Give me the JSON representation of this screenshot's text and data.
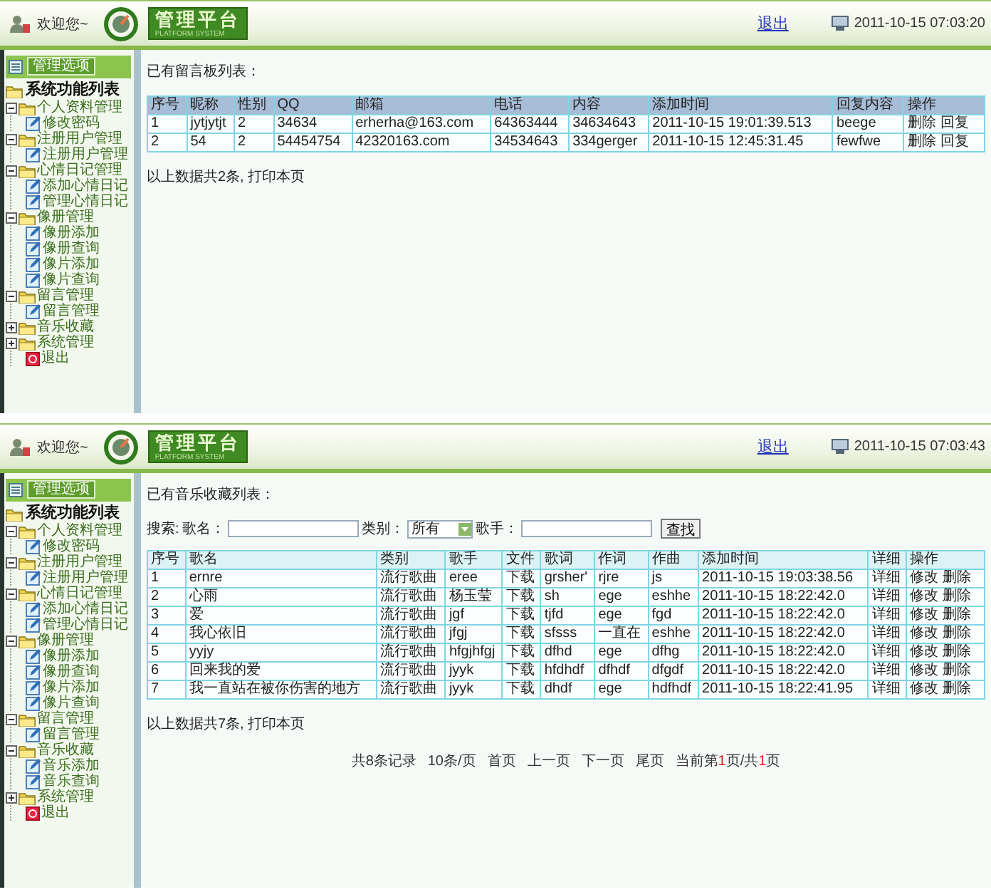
{
  "screens": [
    {
      "header": {
        "welcome": "欢迎您~",
        "brand": "管理平台",
        "brand_subtitle": "PLATFORM SYSTEM",
        "logout": "退出",
        "datetime": "2011-10-15 07:03:20"
      },
      "sidebar": {
        "tab": "管理选项",
        "title": "系统功能列表",
        "items": [
          {
            "kind": "group",
            "label": "个人资料管理",
            "expanded": true,
            "children": [
              {
                "label": "修改密码"
              }
            ]
          },
          {
            "kind": "group",
            "label": "注册用户管理",
            "expanded": true,
            "children": [
              {
                "label": "注册用户管理"
              }
            ]
          },
          {
            "kind": "group",
            "label": "心情日记管理",
            "expanded": true,
            "children": [
              {
                "label": "添加心情日记"
              },
              {
                "label": "管理心情日记"
              }
            ]
          },
          {
            "kind": "group",
            "label": "像册管理",
            "expanded": true,
            "children": [
              {
                "label": "像册添加"
              },
              {
                "label": "像册查询"
              },
              {
                "label": "像片添加"
              },
              {
                "label": "像片查询"
              }
            ]
          },
          {
            "kind": "group",
            "label": "留言管理",
            "expanded": true,
            "children": [
              {
                "label": "留言管理"
              }
            ]
          },
          {
            "kind": "group",
            "label": "音乐收藏",
            "expanded": false
          },
          {
            "kind": "group",
            "label": "系统管理",
            "expanded": false
          },
          {
            "kind": "exit",
            "label": "退出"
          }
        ]
      },
      "content": {
        "heading": "已有留言板列表：",
        "table": {
          "columns": [
            "序号",
            "昵称",
            "性别",
            "QQ",
            "邮箱",
            "电话",
            "内容",
            "添加时间",
            "回复内容",
            "操作"
          ],
          "rows": [
            {
              "cells": [
                "1",
                "jytjytjt",
                "2",
                "34634",
                "erherha@163.com",
                "64363444",
                "34634643",
                "2011-10-15 19:01:39.513",
                "beege"
              ],
              "actions": [
                "删除",
                "回复"
              ]
            },
            {
              "cells": [
                "2",
                "54",
                "2",
                "54454754",
                "42320163.com",
                "34534643",
                "334gerger",
                "2011-10-15 12:45:31.45",
                "fewfwe"
              ],
              "actions": [
                "删除",
                "回复"
              ]
            }
          ]
        },
        "summary": "以上数据共2条, 打印本页"
      }
    },
    {
      "header": {
        "welcome": "欢迎您~",
        "brand": "管理平台",
        "brand_subtitle": "PLATFORM SYSTEM",
        "logout": "退出",
        "datetime": "2011-10-15 07:03:43"
      },
      "sidebar": {
        "tab": "管理选项",
        "title": "系统功能列表",
        "items": [
          {
            "kind": "group",
            "label": "个人资料管理",
            "expanded": true,
            "children": [
              {
                "label": "修改密码"
              }
            ]
          },
          {
            "kind": "group",
            "label": "注册用户管理",
            "expanded": true,
            "children": [
              {
                "label": "注册用户管理"
              }
            ]
          },
          {
            "kind": "group",
            "label": "心情日记管理",
            "expanded": true,
            "children": [
              {
                "label": "添加心情日记"
              },
              {
                "label": "管理心情日记"
              }
            ]
          },
          {
            "kind": "group",
            "label": "像册管理",
            "expanded": true,
            "children": [
              {
                "label": "像册添加"
              },
              {
                "label": "像册查询"
              },
              {
                "label": "像片添加"
              },
              {
                "label": "像片查询"
              }
            ]
          },
          {
            "kind": "group",
            "label": "留言管理",
            "expanded": true,
            "children": [
              {
                "label": "留言管理"
              }
            ]
          },
          {
            "kind": "group",
            "label": "音乐收藏",
            "expanded": true,
            "children": [
              {
                "label": "音乐添加"
              },
              {
                "label": "音乐查询"
              }
            ]
          },
          {
            "kind": "group",
            "label": "系统管理",
            "expanded": false
          },
          {
            "kind": "exit",
            "label": "退出"
          }
        ]
      },
      "content": {
        "heading": "已有音乐收藏列表：",
        "search": {
          "label": "搜索:",
          "fields": [
            {
              "kind": "text",
              "label": "歌名："
            },
            {
              "kind": "select",
              "label": "类别：",
              "value": "所有"
            },
            {
              "kind": "text",
              "label": "歌手："
            }
          ],
          "button": "查找"
        },
        "table": {
          "columns": [
            "序号",
            "歌名",
            "类别",
            "歌手",
            "文件",
            "歌词",
            "作词",
            "作曲",
            "添加时间",
            "详细",
            "操作"
          ],
          "rows": [
            {
              "cells": [
                "1",
                "ernre",
                "流行歌曲",
                "eree",
                "下载",
                "grsher'",
                "rjre",
                "js",
                "2011-10-15 19:03:38.56",
                "详细"
              ],
              "actions": [
                "修改",
                "删除"
              ]
            },
            {
              "cells": [
                "2",
                "心雨",
                "流行歌曲",
                "杨玉莹",
                "下载",
                "sh",
                "ege",
                "eshhe",
                "2011-10-15 18:22:42.0",
                "详细"
              ],
              "actions": [
                "修改",
                "删除"
              ]
            },
            {
              "cells": [
                "3",
                "爱",
                "流行歌曲",
                "jgf",
                "下载",
                "tjfd",
                "ege",
                "fgd",
                "2011-10-15 18:22:42.0",
                "详细"
              ],
              "actions": [
                "修改",
                "删除"
              ]
            },
            {
              "cells": [
                "4",
                "我心依旧",
                "流行歌曲",
                "jfgj",
                "下载",
                "sfsss",
                "一直在",
                "eshhe",
                "2011-10-15 18:22:42.0",
                "详细"
              ],
              "actions": [
                "修改",
                "删除"
              ]
            },
            {
              "cells": [
                "5",
                "yyjy",
                "流行歌曲",
                "hfgjhfgj",
                "下载",
                "dfhd",
                "ege",
                "dfhg",
                "2011-10-15 18:22:42.0",
                "详细"
              ],
              "actions": [
                "修改",
                "删除"
              ]
            },
            {
              "cells": [
                "6",
                "回来我的爱",
                "流行歌曲",
                "jyyk",
                "下载",
                "hfdhdf",
                "dfhdf",
                "dfgdf",
                "2011-10-15 18:22:42.0",
                "详细"
              ],
              "actions": [
                "修改",
                "删除"
              ]
            },
            {
              "cells": [
                "7",
                "我一直站在被你伤害的地方",
                "流行歌曲",
                "jyyk",
                "下载",
                "dhdf",
                "ege",
                "hdfhdf",
                "2011-10-15 18:22:41.95",
                "详细"
              ],
              "actions": [
                "修改",
                "删除"
              ]
            }
          ]
        },
        "summary": "以上数据共7条, 打印本页",
        "pager": {
          "links": [
            "共8条记录",
            "10条/页",
            "首页",
            "上一页",
            "下一页",
            "尾页"
          ],
          "position": {
            "prefix": "当前第",
            "current": "1",
            "middle": "页/共",
            "total": "1",
            "suffix": "页"
          }
        }
      }
    }
  ]
}
